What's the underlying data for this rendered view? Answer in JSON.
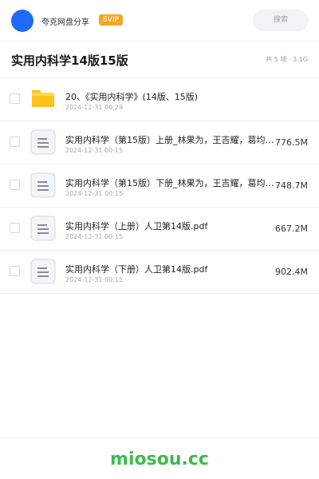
{
  "header": {
    "app_name": "夸克网盘分享",
    "badge": "SVIP",
    "search_placeholder": "搜索",
    "avatar_color": "#1e6bf5",
    "badge_color": "#f5a623"
  },
  "title_row": {
    "title": "实用内科学14版15版",
    "summary": "共 5 项 · 3.1G"
  },
  "files": [
    {
      "type": "folder",
      "icon": "folder-icon",
      "name": "20、《实用内科学》(14版、15版)",
      "date": "2024-12-31 00:29",
      "size": ""
    },
    {
      "type": "file",
      "icon": "document-icon",
      "name": "实用内科学（第15版）上册_林果为，王吉耀，葛均波…",
      "date": "2024-12-31 00:15",
      "size": "776.5M"
    },
    {
      "type": "file",
      "icon": "document-icon",
      "name": "实用内科学（第15版）下册_林果为，王吉耀，葛均波…",
      "date": "2024-12-31 00:15",
      "size": "748.7M"
    },
    {
      "type": "file",
      "icon": "document-icon",
      "name": "实用内科学（上册）人卫第14版.pdf",
      "date": "2024-12-31 00:15",
      "size": "667.2M"
    },
    {
      "type": "file",
      "icon": "document-icon",
      "name": "实用内科学（下册）人卫第14版.pdf",
      "date": "2024-12-31 00:15",
      "size": "902.4M"
    }
  ],
  "footer": {
    "watermark": "miosou.cc",
    "watermark_color": "#3dbb4c"
  }
}
